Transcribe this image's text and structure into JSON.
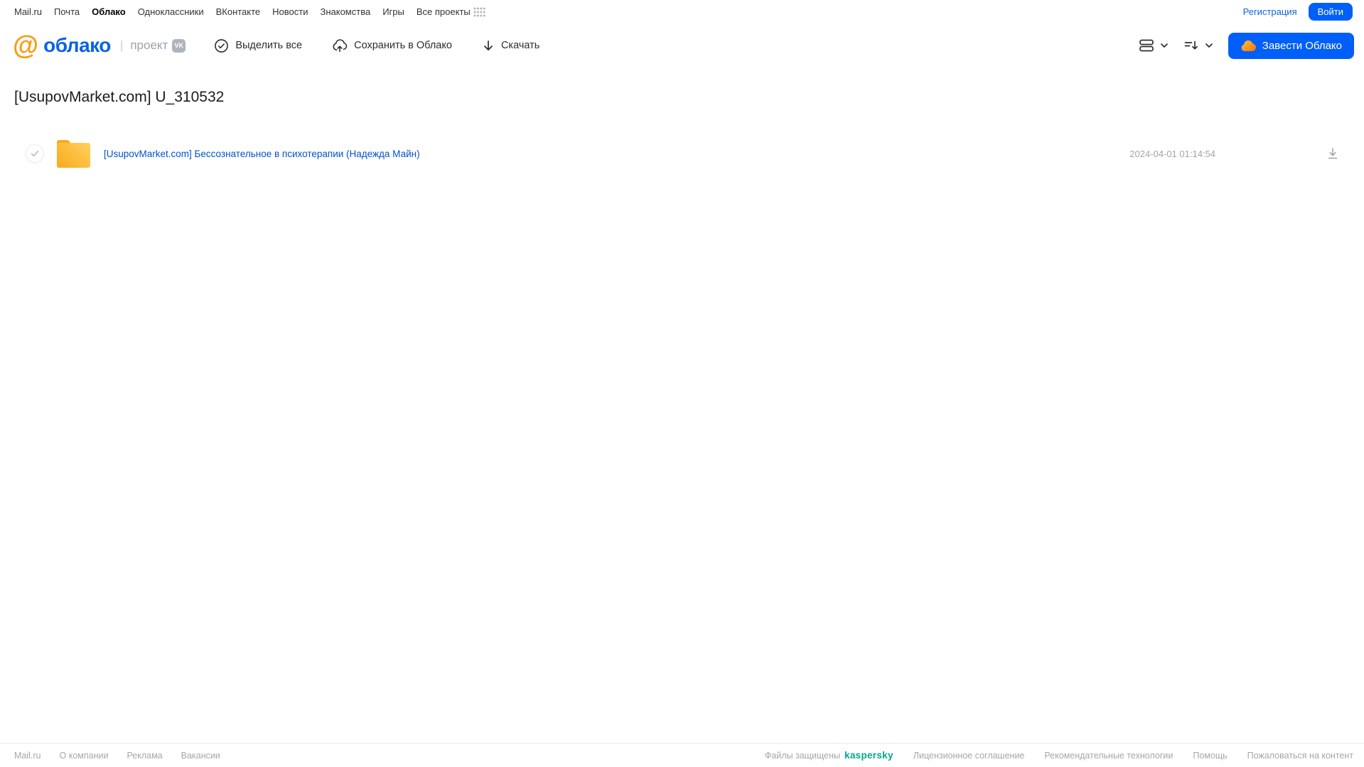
{
  "top_nav": {
    "items": [
      "Mail.ru",
      "Почта",
      "Облако",
      "Одноклассники",
      "ВКонтакте",
      "Новости",
      "Знакомства",
      "Игры",
      "Все проекты"
    ],
    "registration_label": "Регистрация",
    "login_label": "Войти"
  },
  "header": {
    "logo_at": "@",
    "logo_text": "облако",
    "divider": "|",
    "project_label": "проект",
    "vk_badge_label": "VK",
    "select_all_label": "Выделить все",
    "save_to_cloud_label": "Сохранить в Облако",
    "download_label": "Скачать",
    "get_cloud_label": "Завести Облако"
  },
  "content": {
    "page_title": "[UsupovMarket.com] U_310532",
    "files": [
      {
        "type": "folder",
        "name": "[UsupovMarket.com] Бессознательное в психотерапии (Надежда Майн)",
        "modified": "2024-04-01 01:14:54"
      }
    ]
  },
  "footer": {
    "links_left": [
      "Mail.ru",
      "О компании",
      "Реклама",
      "Вакансии"
    ],
    "protected_by": "Файлы защищены",
    "kaspersky_label": "kaspersky",
    "links_right": [
      "Лицензионное соглашение",
      "Рекомендательные технологии",
      "Помощь",
      "Пожаловаться на контент"
    ]
  },
  "colors": {
    "accent_blue": "#005ff9",
    "logo_blue": "#0b63e4",
    "link_blue": "#0052cc",
    "logo_orange": "#f89c12",
    "folder_yellow": "#f9a91e",
    "kaspersky_teal": "#00a88e",
    "muted_gray": "#a6a6a6"
  }
}
